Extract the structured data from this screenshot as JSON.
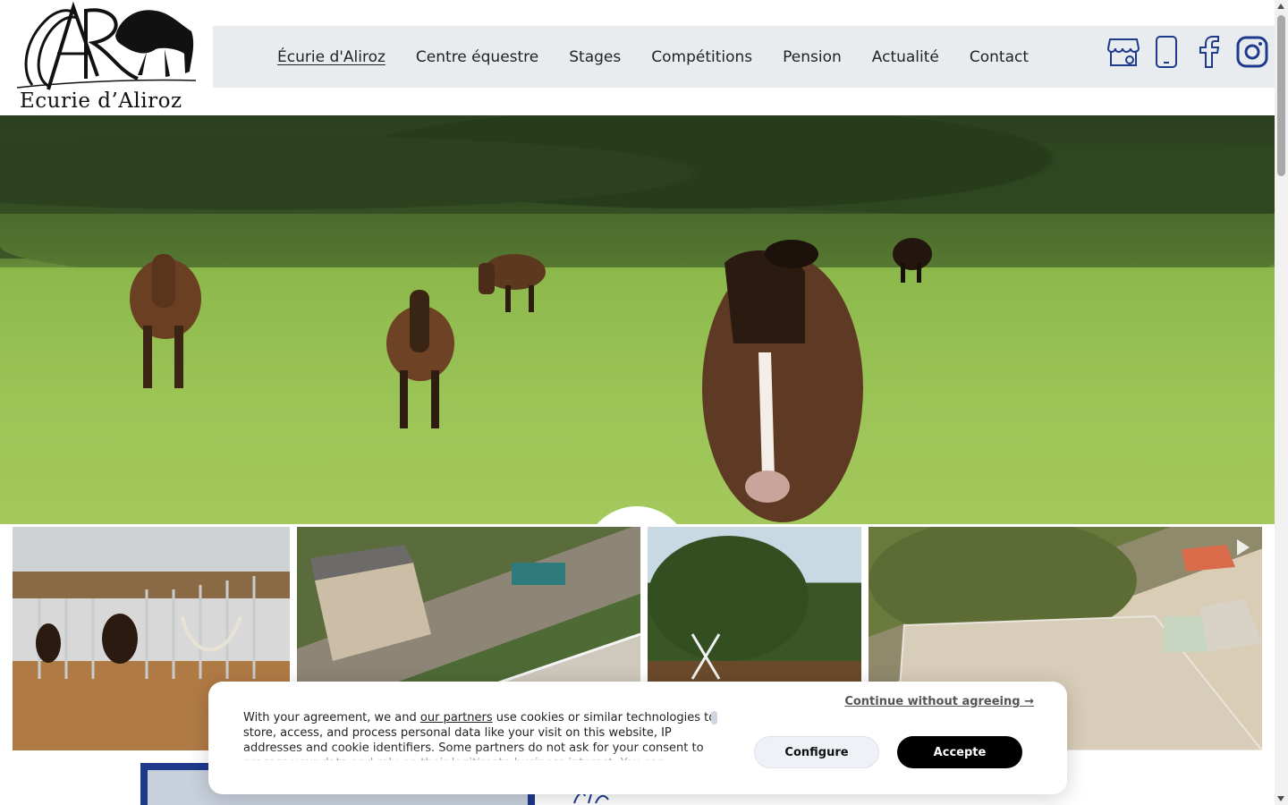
{
  "brand": {
    "name": "Ecurie d’Aliroz",
    "monogram": "AR"
  },
  "nav": {
    "items": [
      {
        "label": "Écurie d'Aliroz",
        "active": true
      },
      {
        "label": "Centre équestre",
        "active": false
      },
      {
        "label": "Stages",
        "active": false
      },
      {
        "label": "Compétitions",
        "active": false
      },
      {
        "label": "Pension",
        "active": false
      },
      {
        "label": "Actualité",
        "active": false
      },
      {
        "label": "Contact",
        "active": false
      }
    ]
  },
  "social": {
    "icons": [
      "google-business-icon",
      "phone-icon",
      "facebook-icon",
      "instagram-icon"
    ],
    "color": "#1d3a8c"
  },
  "hero": {
    "alt": "horses grazing in a meadow"
  },
  "gallery": {
    "images": [
      "stable-boxes",
      "aerial-estate",
      "jumping-arena-trees",
      "aerial-arena"
    ]
  },
  "cookie": {
    "text_before": "With your agreement, we and ",
    "link": "our partners",
    "text_after": " use cookies or similar technologies to store, access, and process personal data like your visit on this website, IP addresses and cookie identifiers. Some partners do not ask for your consent to process your data and rely on their legitimate business interest. You can",
    "continue_label": "Continue without agreeing →",
    "configure_label": "Configure",
    "accept_label": "Accepte"
  },
  "colors": {
    "nav_bg": "#e9ecef",
    "accent": "#1d3a8c"
  }
}
